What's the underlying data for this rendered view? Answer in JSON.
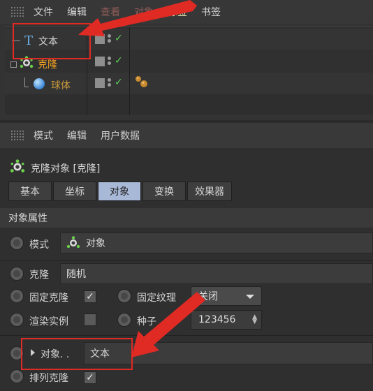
{
  "object_manager": {
    "menu": [
      {
        "label": "文件",
        "style": "normal"
      },
      {
        "label": "编辑",
        "style": "normal"
      },
      {
        "label": "查看",
        "style": "dim"
      },
      {
        "label": "对象",
        "style": "dim"
      },
      {
        "label": "标签",
        "style": "hl"
      },
      {
        "label": "书签",
        "style": "normal"
      }
    ],
    "objects": [
      {
        "name": "文本",
        "icon": "text-icon",
        "color": "#d7d7d7"
      },
      {
        "name": "克隆",
        "icon": "cloner-icon",
        "color": "#f0a020"
      },
      {
        "name": "球体",
        "icon": "sphere-icon",
        "color": "#c89a3c"
      }
    ],
    "tag_icon": "material-tag-icon"
  },
  "attribute_manager": {
    "menu": [
      "模式",
      "编辑",
      "用户数据"
    ],
    "title": "克隆对象 [克隆]",
    "tabs": [
      {
        "label": "基本",
        "active": false
      },
      {
        "label": "坐标",
        "active": false
      },
      {
        "label": "对象",
        "active": true
      },
      {
        "label": "变换",
        "active": false
      },
      {
        "label": "效果器",
        "active": false
      }
    ],
    "section_title": "对象属性",
    "mode_label": "模式",
    "mode_value": "对象",
    "clone_label": "克隆",
    "clone_value": "随机",
    "fix_clone_label": "固定克隆",
    "fix_clone_check": "✓",
    "fix_texture_label": "固定纹理",
    "fix_texture_value": "关闭",
    "render_instances_label": "渲染实例",
    "seed_label": "种子",
    "seed_value": "123456",
    "object_label": "对象. .",
    "object_value": "文本",
    "arrange_clone_label": "排列克隆",
    "arrange_clone_check": "✓"
  },
  "colors": {
    "annotation_red": "#e02a24",
    "active_tab": "#a8b9d8",
    "check_green": "#5ad05a"
  }
}
